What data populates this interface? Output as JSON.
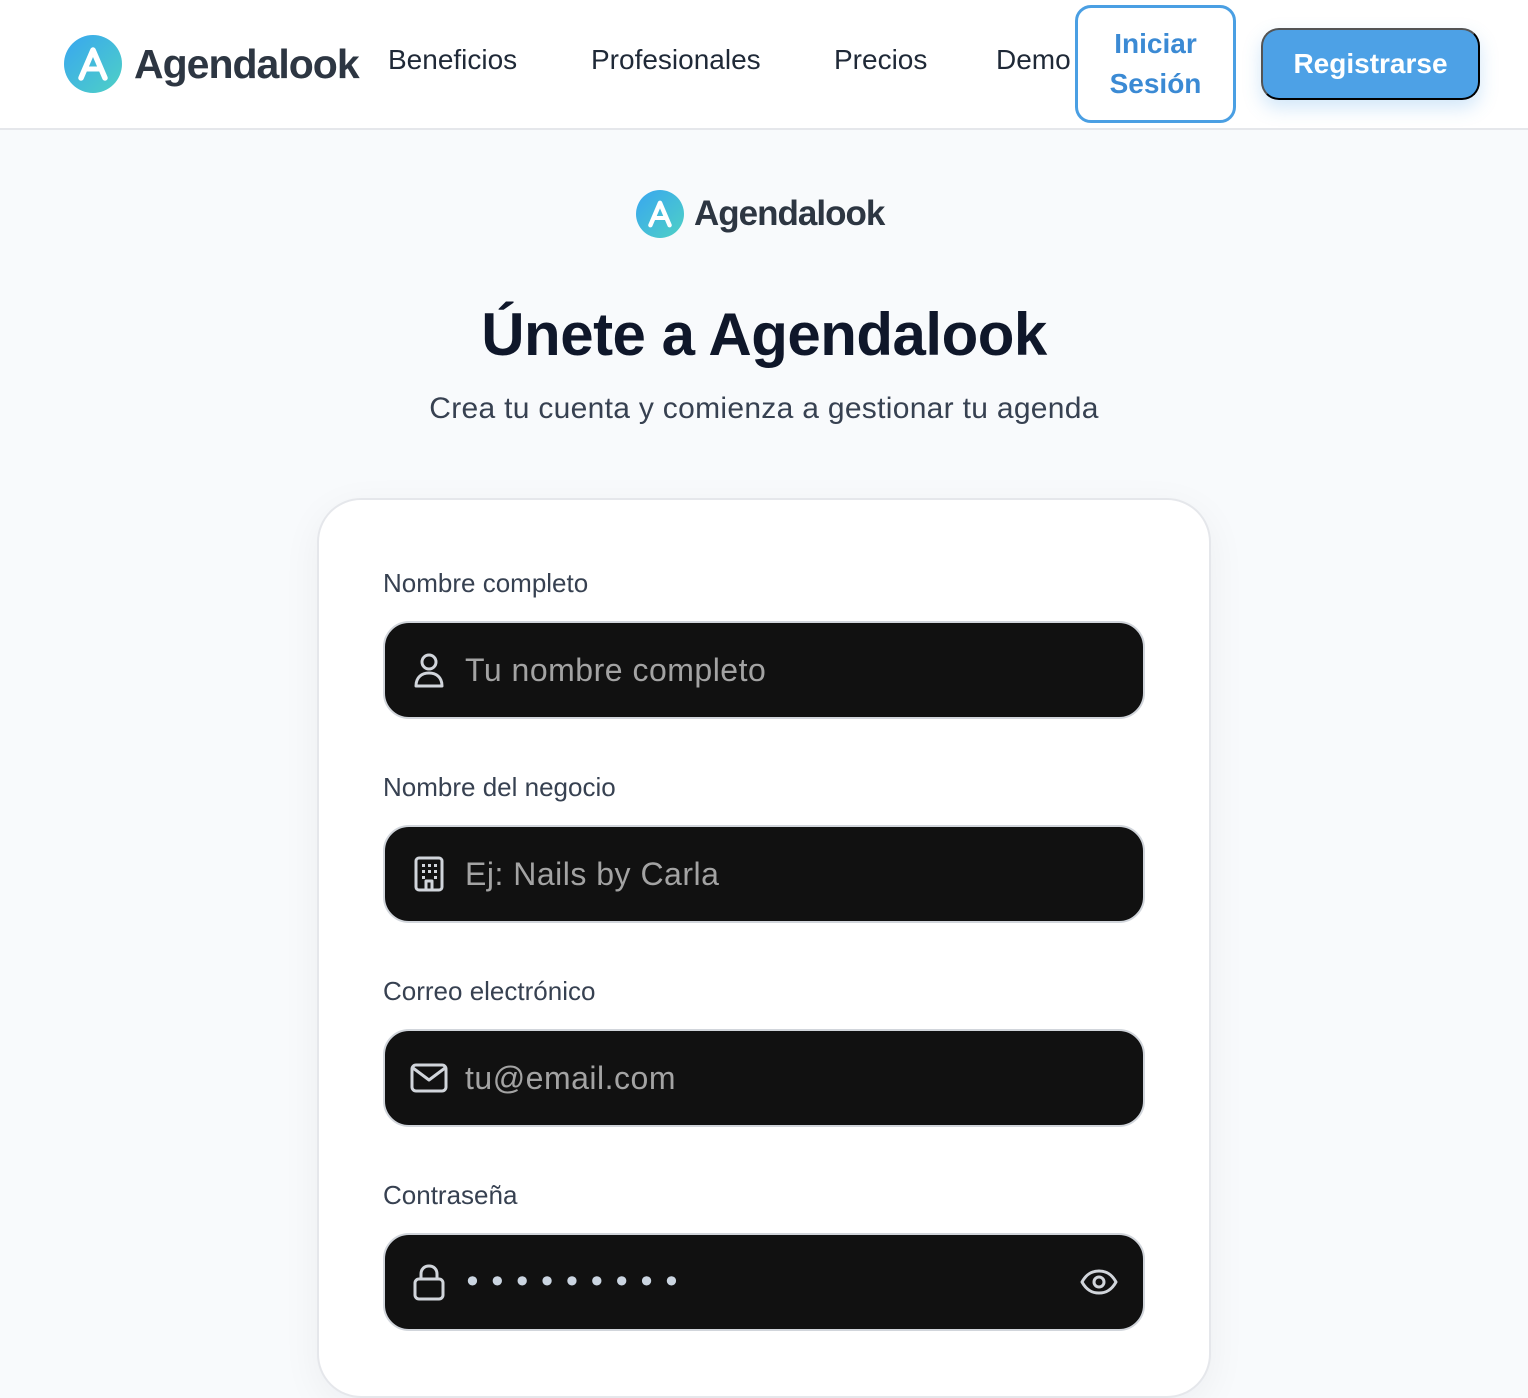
{
  "header": {
    "brand_name": "Agendalook",
    "brand_letter": "A",
    "nav": [
      "Beneficios",
      "Profesionales",
      "Precios",
      "Demo"
    ],
    "login_label": "Iniciar Sesión",
    "register_label": "Registrarse"
  },
  "hero": {
    "brand_name": "Agendalook",
    "brand_letter": "A",
    "title": "Únete a Agendalook",
    "subtitle": "Crea tu cuenta y comienza a gestionar tu agenda"
  },
  "form": {
    "full_name": {
      "label": "Nombre completo",
      "placeholder": "Tu nombre completo",
      "icon": "user-icon"
    },
    "business_name": {
      "label": "Nombre del negocio",
      "placeholder": "Ej: Nails by Carla",
      "icon": "building-icon"
    },
    "email": {
      "label": "Correo electrónico",
      "placeholder": "tu@email.com",
      "icon": "mail-icon"
    },
    "password": {
      "label": "Contraseña",
      "value": "•••••••••",
      "icon": "lock-icon",
      "toggle_icon": "eye-icon"
    }
  },
  "colors": {
    "accent": "#4da1e6",
    "accent_text": "#3b8ad4",
    "input_bg": "#111111",
    "title": "#0f172a"
  }
}
